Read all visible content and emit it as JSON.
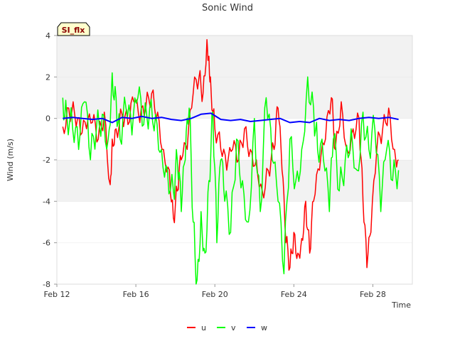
{
  "chart_data": {
    "type": "line",
    "title": "Sonic Wind",
    "badge": "SI_flx",
    "xlabel": "Time",
    "ylabel": "Wind (m/s)",
    "x_ticks": [
      "Feb 12",
      "Feb 16",
      "Feb 20",
      "Feb 24",
      "Feb 28"
    ],
    "x_tick_days": [
      12,
      16,
      20,
      24,
      28
    ],
    "xlim": [
      12,
      30
    ],
    "ylim": [
      -8,
      4
    ],
    "y_ticks": [
      -8,
      -6,
      -4,
      -2,
      0,
      2,
      4
    ],
    "grid": "horizontal bands",
    "legend_position": "bottom-center",
    "colors": {
      "u": "#ff0000",
      "v": "#00ff00",
      "w": "#0000ff",
      "band": "#f2f2f2"
    },
    "series": [
      {
        "name": "u",
        "color": "#ff0000",
        "x": [
          12.3,
          12.6,
          12.9,
          13.2,
          13.5,
          13.8,
          14.1,
          14.4,
          14.7,
          14.8,
          15.0,
          15.3,
          15.6,
          15.9,
          16.2,
          16.5,
          16.8,
          17.1,
          17.4,
          17.7,
          17.9,
          18.1,
          18.3,
          18.6,
          18.9,
          19.2,
          19.4,
          19.6,
          19.7,
          19.8,
          20.0,
          20.3,
          20.6,
          20.9,
          21.2,
          21.5,
          21.8,
          22.1,
          22.4,
          22.7,
          23.0,
          23.2,
          23.4,
          23.6,
          23.8,
          24.0,
          24.2,
          24.4,
          24.6,
          24.8,
          25.0,
          25.3,
          25.6,
          25.9,
          26.1,
          26.4,
          26.7,
          27.0,
          27.3,
          27.5,
          27.7,
          27.9,
          28.2,
          28.5,
          28.8,
          29.1,
          29.3
        ],
        "values": [
          -0.4,
          0.5,
          0.2,
          -0.8,
          -0.5,
          -0.2,
          -1.0,
          0.3,
          -3.2,
          -1.0,
          -0.5,
          0.2,
          -0.3,
          0.8,
          -0.2,
          0.5,
          1.2,
          0.3,
          -1.5,
          -2.5,
          -4.8,
          -3.5,
          -2.0,
          -1.5,
          1.2,
          2.0,
          1.2,
          3.8,
          3.0,
          1.5,
          -0.5,
          -1.5,
          -2.5,
          -1.5,
          -2.0,
          -0.5,
          -1.5,
          -2.0,
          -3.5,
          -2.5,
          -1.5,
          0.5,
          -2.5,
          -6.0,
          -7.2,
          -5.5,
          -6.5,
          -5.8,
          -4.0,
          -6.5,
          -4.0,
          -2.5,
          -1.0,
          1.0,
          -1.5,
          0.8,
          -1.5,
          -0.5,
          0.0,
          -4.0,
          -7.2,
          -5.5,
          -1.5,
          -0.5,
          0.5,
          -1.5,
          -2.0
        ]
      },
      {
        "name": "v",
        "color": "#00ff00",
        "x": [
          12.3,
          12.5,
          12.8,
          13.1,
          13.4,
          13.7,
          14.0,
          14.3,
          14.6,
          14.8,
          15.0,
          15.2,
          15.5,
          15.8,
          16.1,
          16.4,
          16.7,
          17.0,
          17.3,
          17.6,
          17.9,
          18.1,
          18.3,
          18.5,
          18.7,
          18.9,
          19.1,
          19.3,
          19.5,
          19.7,
          19.9,
          20.1,
          20.3,
          20.5,
          20.8,
          21.1,
          21.4,
          21.7,
          22.0,
          22.3,
          22.6,
          22.9,
          23.2,
          23.5,
          23.8,
          24.1,
          24.4,
          24.7,
          25.0,
          25.2,
          25.5,
          25.8,
          26.0,
          26.3,
          26.6,
          26.9,
          27.2,
          27.5,
          27.8,
          28.1,
          28.4,
          28.7,
          29.0,
          29.3
        ],
        "values": [
          1.0,
          0.2,
          -0.5,
          -1.5,
          0.8,
          -2.0,
          -0.5,
          0.2,
          -1.0,
          2.2,
          1.0,
          -1.0,
          0.5,
          -0.8,
          1.0,
          -0.3,
          0.5,
          0.2,
          -1.5,
          -2.5,
          -3.5,
          -2.0,
          -4.5,
          -2.0,
          0.5,
          -5.0,
          -7.8,
          -4.5,
          -6.5,
          -3.0,
          0.3,
          -6.0,
          -2.0,
          -4.0,
          -5.5,
          -1.0,
          -3.0,
          -5.0,
          0.0,
          -4.5,
          1.0,
          -2.0,
          -4.0,
          -7.5,
          -1.0,
          -3.0,
          -1.5,
          2.0,
          0.5,
          -1.5,
          -2.0,
          -4.5,
          -1.0,
          -3.5,
          -2.0,
          -0.5,
          -2.5,
          0.3,
          -1.5,
          -0.5,
          -4.5,
          -1.5,
          -3.0,
          -2.5
        ]
      },
      {
        "name": "w",
        "color": "#0000ff",
        "x": [
          12.3,
          12.8,
          13.3,
          13.8,
          14.3,
          14.8,
          15.3,
          15.8,
          16.3,
          16.8,
          17.3,
          17.8,
          18.3,
          18.8,
          19.3,
          19.8,
          20.3,
          20.8,
          21.3,
          21.8,
          22.3,
          22.8,
          23.3,
          23.8,
          24.3,
          24.8,
          25.3,
          25.8,
          26.3,
          26.8,
          27.3,
          27.8,
          28.3,
          28.8,
          29.3
        ],
        "values": [
          0.0,
          0.05,
          0.0,
          -0.05,
          0.0,
          -0.2,
          0.05,
          0.0,
          0.1,
          0.0,
          0.05,
          -0.05,
          -0.1,
          0.0,
          0.2,
          0.25,
          -0.05,
          -0.1,
          -0.05,
          -0.15,
          -0.1,
          -0.05,
          0.0,
          -0.2,
          -0.15,
          -0.2,
          0.0,
          -0.1,
          -0.05,
          -0.1,
          0.0,
          0.05,
          0.0,
          0.05,
          -0.05
        ]
      }
    ]
  }
}
